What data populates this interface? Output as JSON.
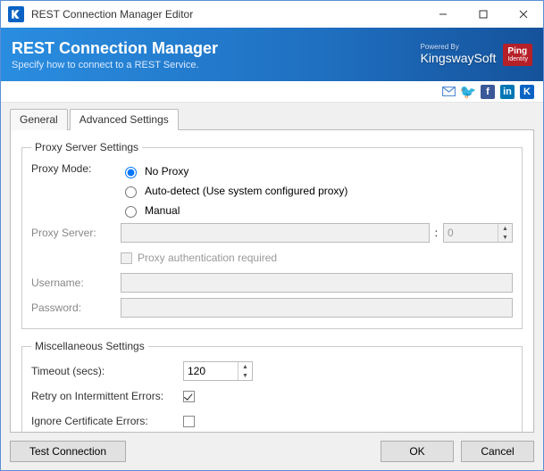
{
  "window": {
    "title": "REST Connection Manager Editor"
  },
  "banner": {
    "heading": "REST Connection Manager",
    "sub": "Specify how to connect to a REST Service.",
    "poweredBy": "Powered By",
    "kingsway": "KingswaySoft",
    "ping": "Ping",
    "pingSub": "Identity"
  },
  "tabs": {
    "general": "General",
    "advanced": "Advanced Settings"
  },
  "proxy": {
    "legend": "Proxy Server Settings",
    "modeLabel": "Proxy Mode:",
    "noProxy": "No Proxy",
    "autoDetect": "Auto-detect (Use system configured proxy)",
    "manual": "Manual",
    "serverLabel": "Proxy Server:",
    "serverValue": "",
    "portValue": "0",
    "authReq": "Proxy authentication required",
    "usernameLabel": "Username:",
    "usernameValue": "",
    "passwordLabel": "Password:",
    "passwordValue": ""
  },
  "misc": {
    "legend": "Miscellaneous Settings",
    "timeoutLabel": "Timeout (secs):",
    "timeoutValue": "120",
    "retryLabel": "Retry on Intermittent Errors:",
    "ignoreCertLabel": "Ignore Certificate Errors:"
  },
  "buttons": {
    "test": "Test Connection",
    "ok": "OK",
    "cancel": "Cancel"
  }
}
